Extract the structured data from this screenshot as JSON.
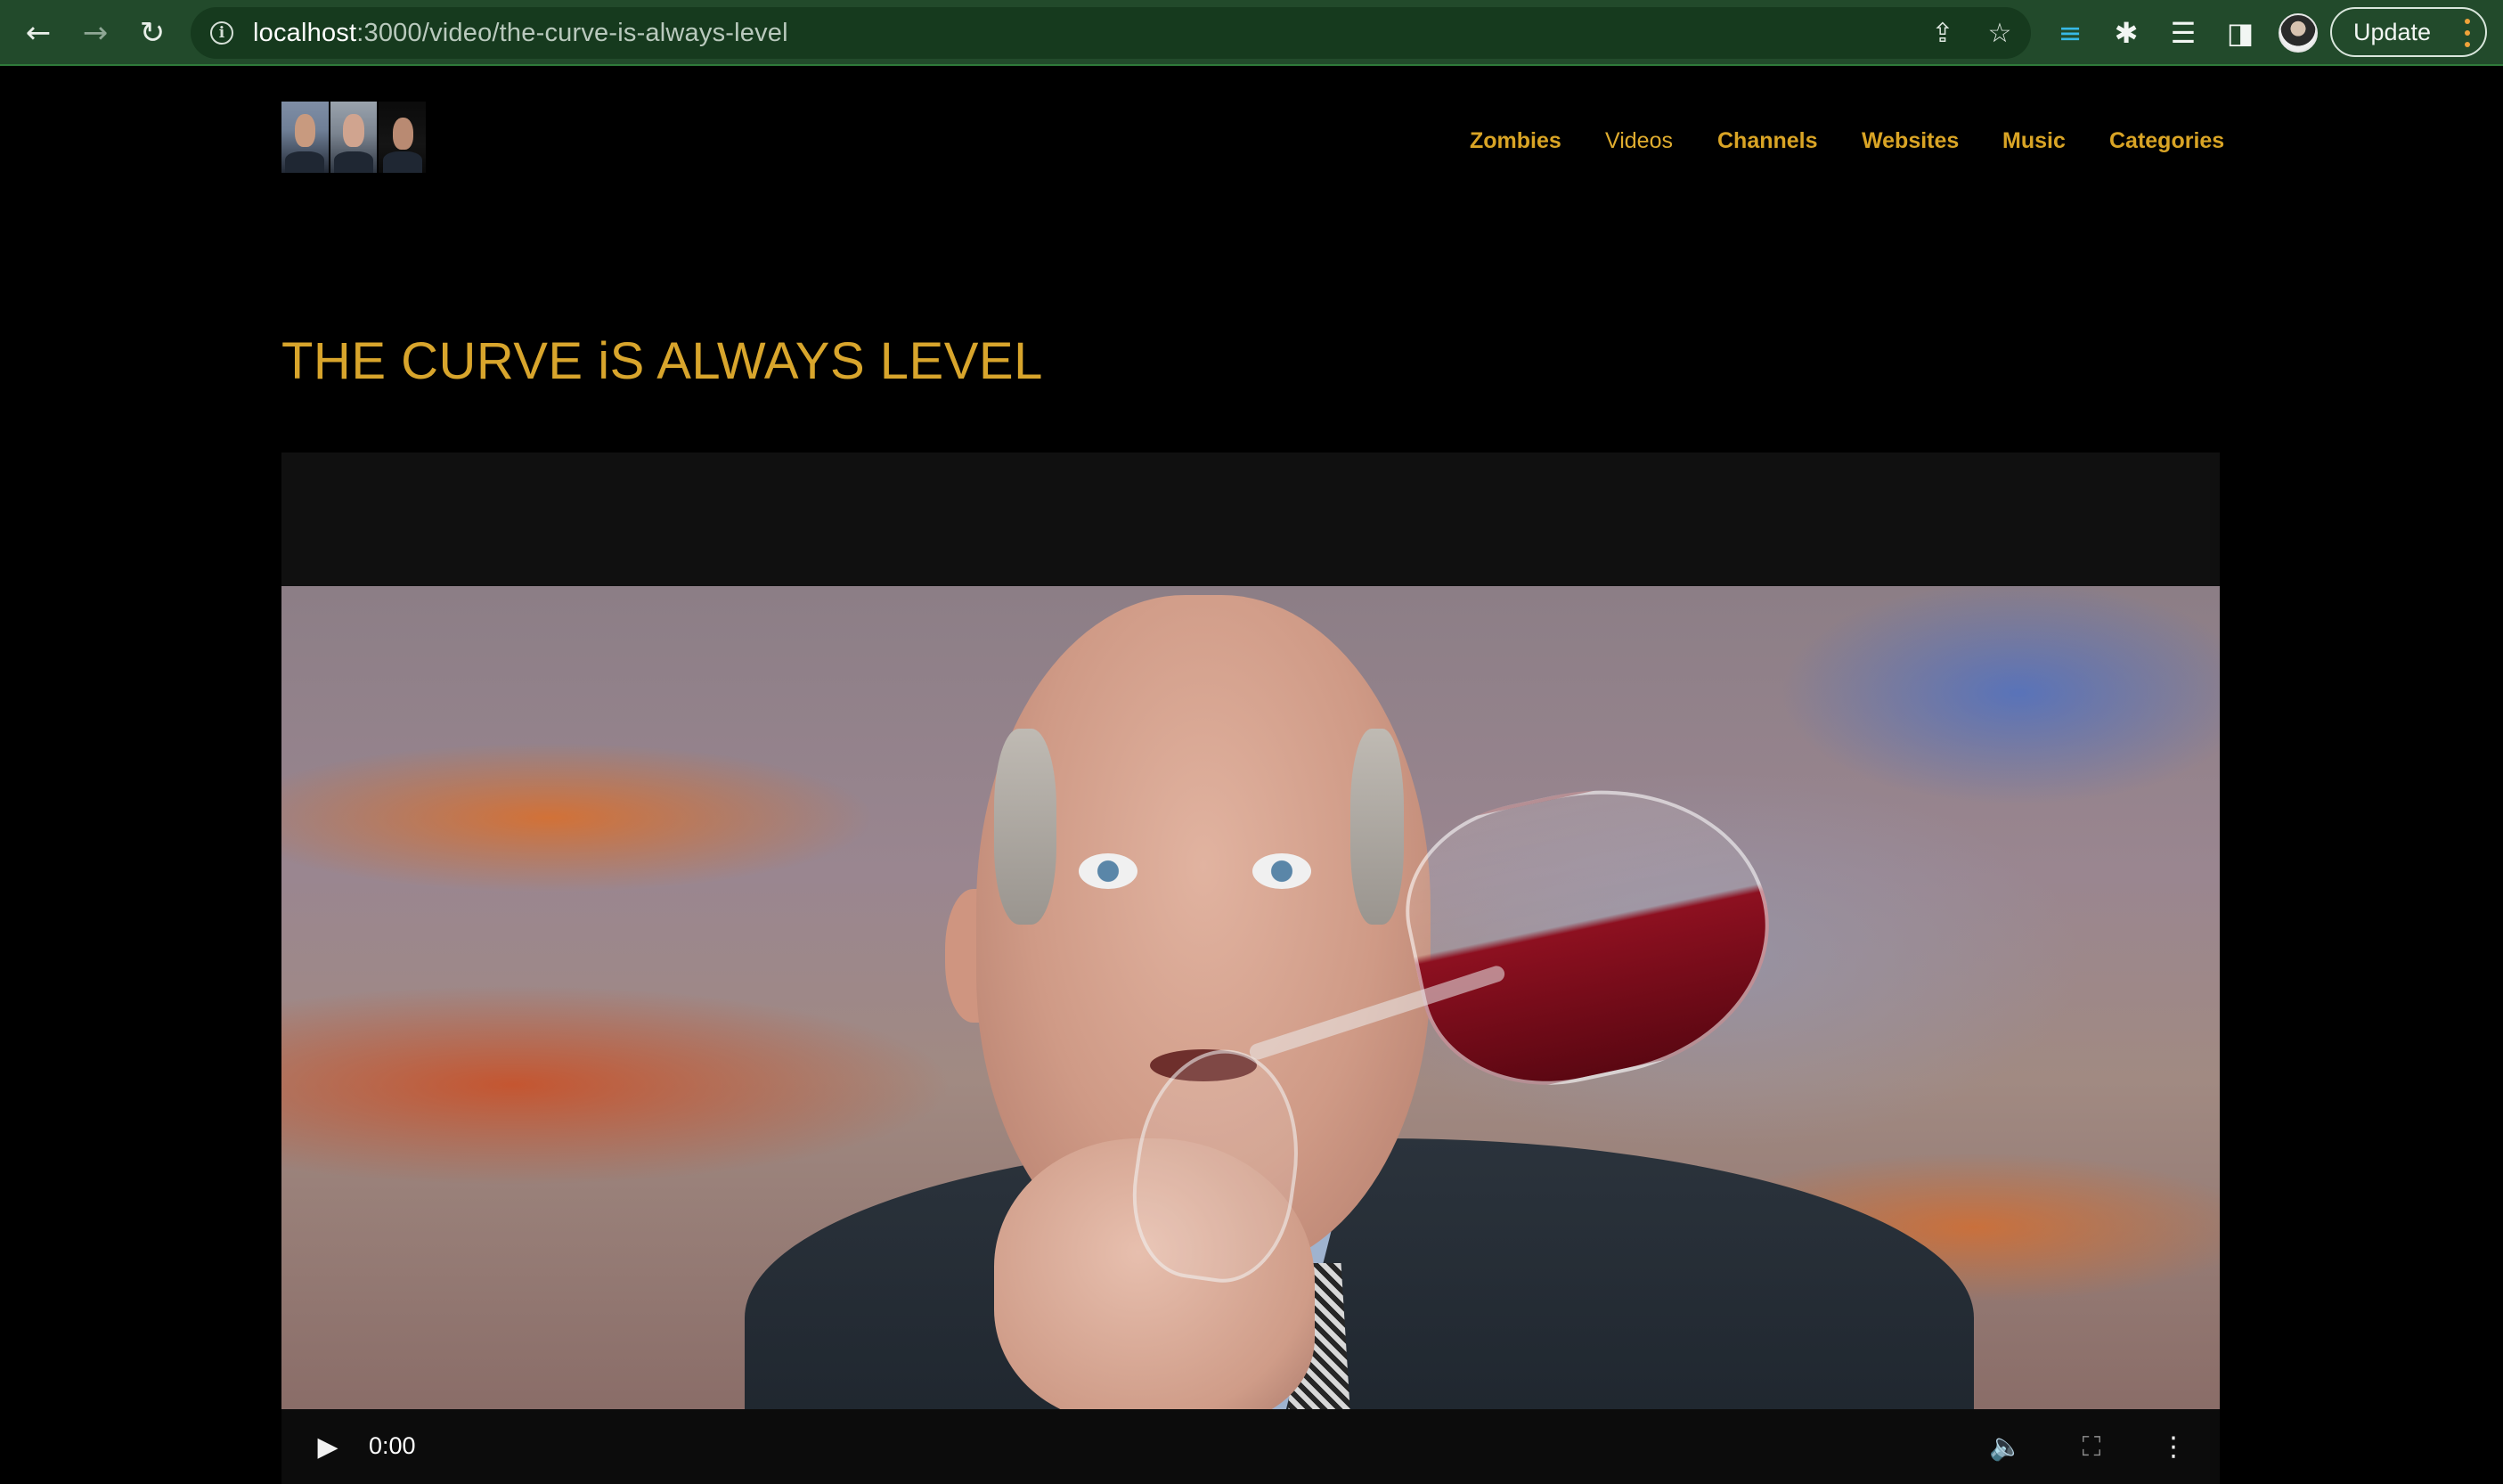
{
  "browser": {
    "url_host": "localhost",
    "url_path": ":3000/video/the-curve-is-always-level",
    "update_label": "Update",
    "icons": {
      "back": "arrow-left-icon",
      "forward": "arrow-right-icon",
      "reload": "reload-icon",
      "site_info": "info-icon",
      "share": "share-icon",
      "bookmark": "star-icon",
      "extension_filter": "filter-icon",
      "extensions": "puzzle-icon",
      "reading_list": "reading-list-icon",
      "side_panel": "side-panel-icon",
      "menu": "kebab-menu-icon"
    },
    "accent": "#f0a33a"
  },
  "site": {
    "nav": [
      "Zombies",
      "Videos",
      "Channels",
      "Websites",
      "Music",
      "Categories"
    ],
    "nav_color": "#d9a425",
    "title": "THE CURVE iS ALWAYS LEVEL",
    "title_color": "#d8a52c"
  },
  "player": {
    "current_time": "0:00",
    "icons": {
      "play": "play-icon",
      "volume": "volume-icon",
      "fullscreen": "fullscreen-icon",
      "options": "kebab-menu-icon"
    }
  }
}
